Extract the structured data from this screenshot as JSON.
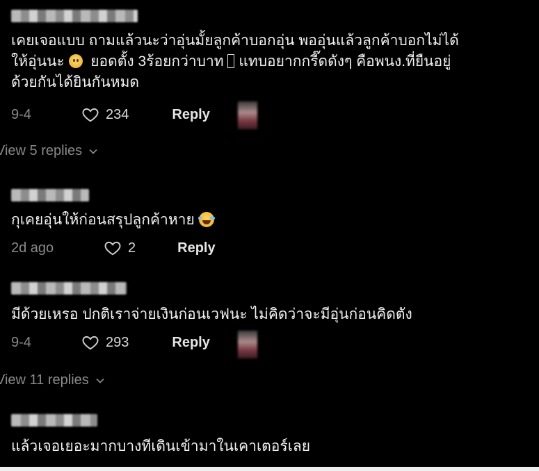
{
  "comments": [
    {
      "text_part1": "เคยเจอแบบ ถามแล้วนะว่าอุ่นมั้ยลูกค้าบอกอุ่น พออุ่นแล้วลูกค้าบอกไม่ได้\nให้อุ่นนะ ",
      "emoji1": "slightly-frowning-face-emoji",
      "text_part2": "  ยอดตั้ง 3ร้อยกว่าบาท ",
      "glyph_missing": "unsupported-glyph-box",
      "text_part3": " แทบอยากกรี๊ดดังๆ คือพนง.ที่ยืนอยู่\nด้วยกันได้ยินกันหมด",
      "date": "9-4",
      "likes": "234",
      "reply_label": "Reply",
      "view_replies": "View 5 replies"
    },
    {
      "text": "กุเคยอุ่นให้ก่อนสรุปลูกค้าหาย",
      "emoji": "face-with-tears-of-joy-emoji",
      "date": "2d ago",
      "likes": "2",
      "reply_label": "Reply"
    },
    {
      "text": "มีด้วยเหรอ ปกติเราจ่ายเงินก่อนเวฟนะ ไม่คิดว่าจะมีอุ่นก่อนคิดตัง",
      "date": "9-4",
      "likes": "293",
      "reply_label": "Reply",
      "view_replies": "View 11 replies"
    },
    {
      "text": "แล้วเจอเยอะมากบางทีเดินเข้ามาในเคาเตอร์เลย"
    }
  ],
  "colors": {
    "background": "#000000",
    "text": "#f1f1f1",
    "muted": "#8a8a8a",
    "reply": "#e5e5e5"
  },
  "icons": {
    "like": "heart-outline-icon",
    "expand": "chevron-down-icon"
  }
}
